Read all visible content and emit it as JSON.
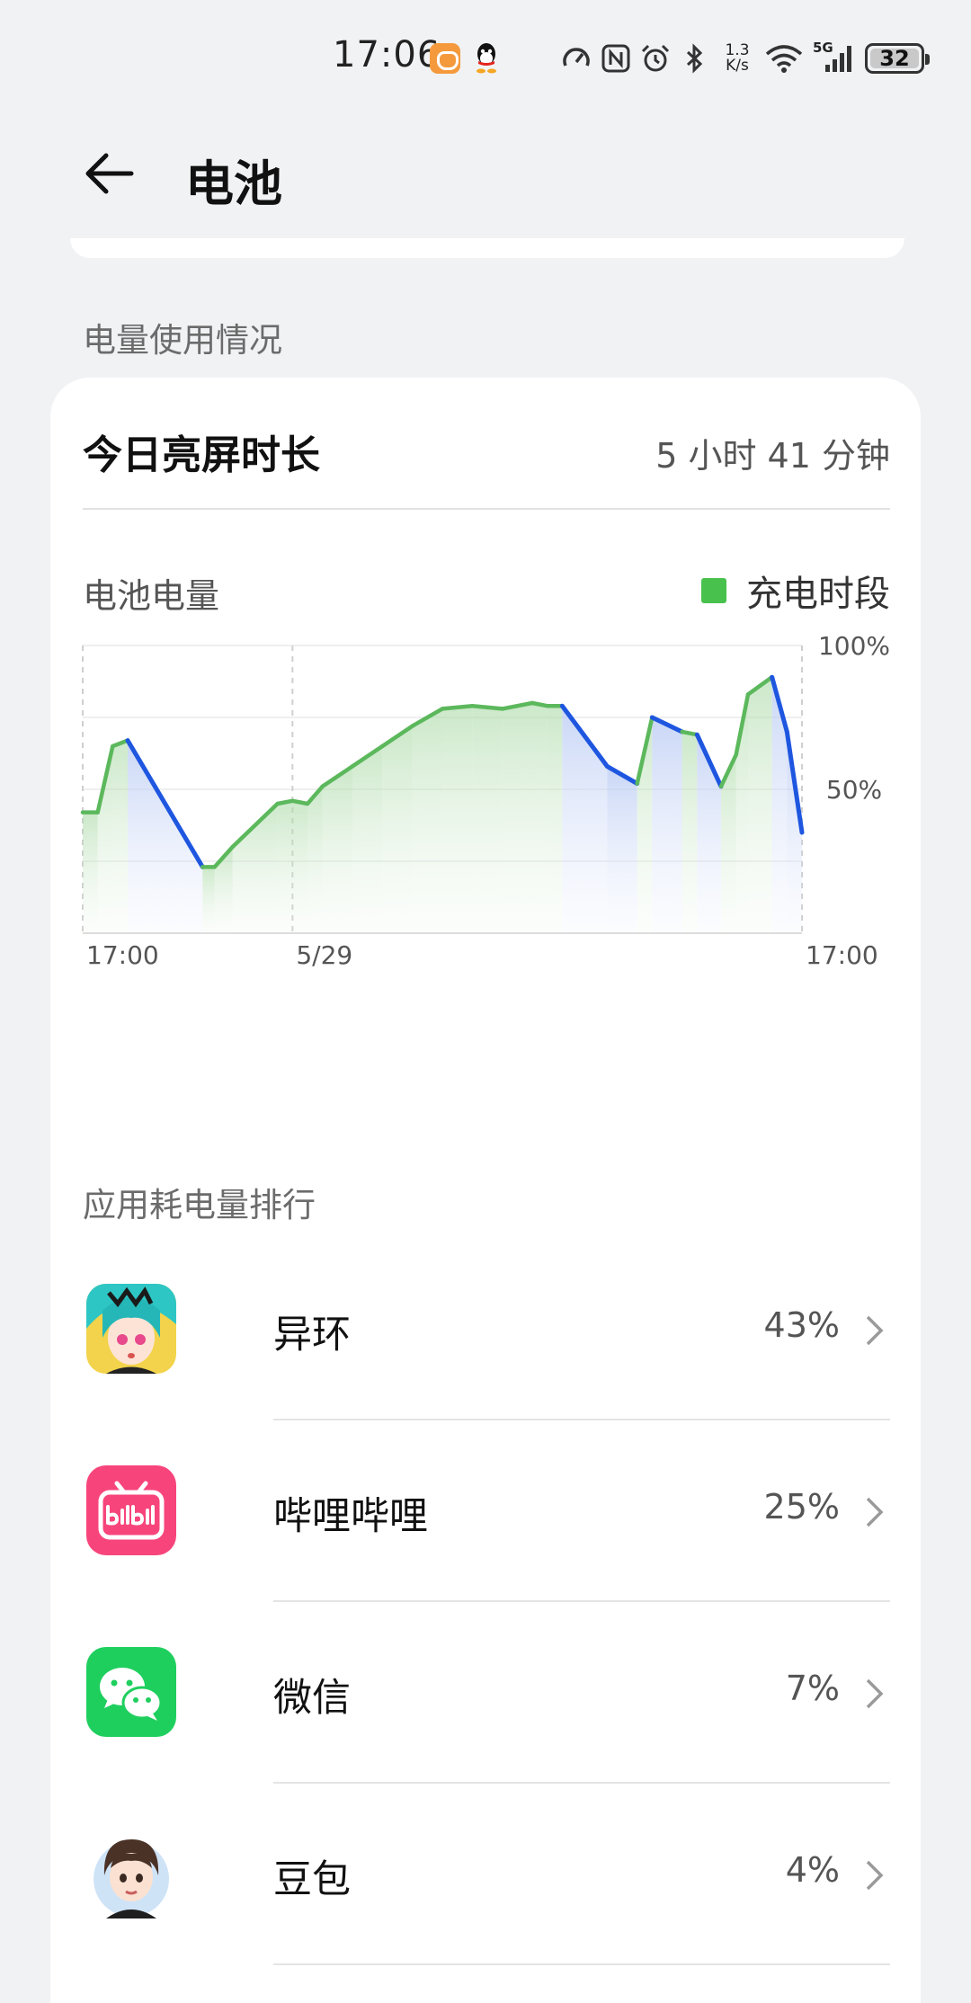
{
  "status_bar": {
    "time": "17:06",
    "net_speed_value": "1.3",
    "net_speed_unit": "K/s",
    "signal_label": "5G",
    "battery_level": "32"
  },
  "header": {
    "title": "电池"
  },
  "usage_section": {
    "label": "电量使用情况"
  },
  "screen_time": {
    "label": "今日亮屏时长",
    "value": "5 小时 41 分钟"
  },
  "battery_chart": {
    "title": "电池电量",
    "legend_label": "充电时段",
    "colors": {
      "charging": "#5cb85c",
      "discharging": "#1e56e0",
      "legend": "#48c24d"
    },
    "y_tick_labels": [
      "100%",
      "50%"
    ],
    "x_tick_labels": [
      "17:00",
      "5/29",
      "17:00"
    ]
  },
  "chart_data": {
    "type": "line",
    "title": "电池电量",
    "ylabel": "",
    "xlabel": "",
    "ylim": [
      0,
      100
    ],
    "xlim": [
      0,
      24
    ],
    "x_ticks": [
      0,
      7,
      24
    ],
    "x_tick_labels": [
      "17:00",
      "5/29",
      "17:00"
    ],
    "y_ticks": [
      50,
      100
    ],
    "y_tick_labels": [
      "50%",
      "100%"
    ],
    "grid": true,
    "legend": "top-right",
    "series": [
      {
        "name": "充电时段",
        "x": [
          0,
          0.5,
          1.0,
          1.5,
          4.0,
          4.4,
          5.0,
          6.5,
          7.0,
          7.5,
          8.0,
          9.0,
          10.0,
          11.0,
          12.0,
          13.0,
          14.0,
          15.0,
          15.5,
          15.75,
          16.0,
          17.5,
          18.5,
          19.0,
          20.0,
          20.5,
          21.3,
          21.8,
          22.2,
          23.0,
          23.5,
          24.0
        ],
        "y": [
          42,
          42,
          65,
          67,
          23,
          23,
          30,
          45,
          46,
          45,
          51,
          58,
          65,
          72,
          78,
          79,
          78,
          80,
          79,
          79,
          79,
          58,
          52,
          75,
          70,
          69,
          51,
          62,
          83,
          89,
          70,
          35
        ]
      }
    ]
  },
  "rank_section": {
    "label": "应用耗电量排行"
  },
  "apps": [
    {
      "name": "异环",
      "percent": "43%",
      "icon": "yihuan-app-icon"
    },
    {
      "name": "哔哩哔哩",
      "percent": "25%",
      "icon": "bilibili-app-icon"
    },
    {
      "name": "微信",
      "percent": "7%",
      "icon": "wechat-app-icon"
    },
    {
      "name": "豆包",
      "percent": "4%",
      "icon": "doubao-app-icon"
    }
  ]
}
